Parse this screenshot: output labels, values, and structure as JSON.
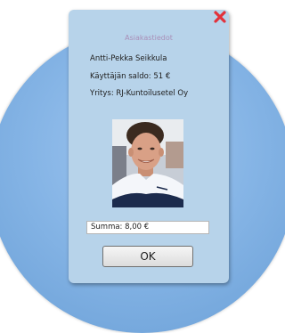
{
  "dialog": {
    "title": "Asiakastiedot",
    "name": "Antti-Pekka Seikkula",
    "balance": "Käyttäjän saldo: 51 €",
    "company": "Yritys: RJ-Kuntoilusetel Oy",
    "amount": "Summa: 8,00 €",
    "ok_label": "OK",
    "close_icon": "close-x-icon",
    "photo": "user-photo"
  },
  "colors": {
    "background_circle": "#86b5e6",
    "dialog_bg": "#b7d3ea",
    "close_icon": "#e2313b",
    "title_text": "#a98fb8"
  }
}
